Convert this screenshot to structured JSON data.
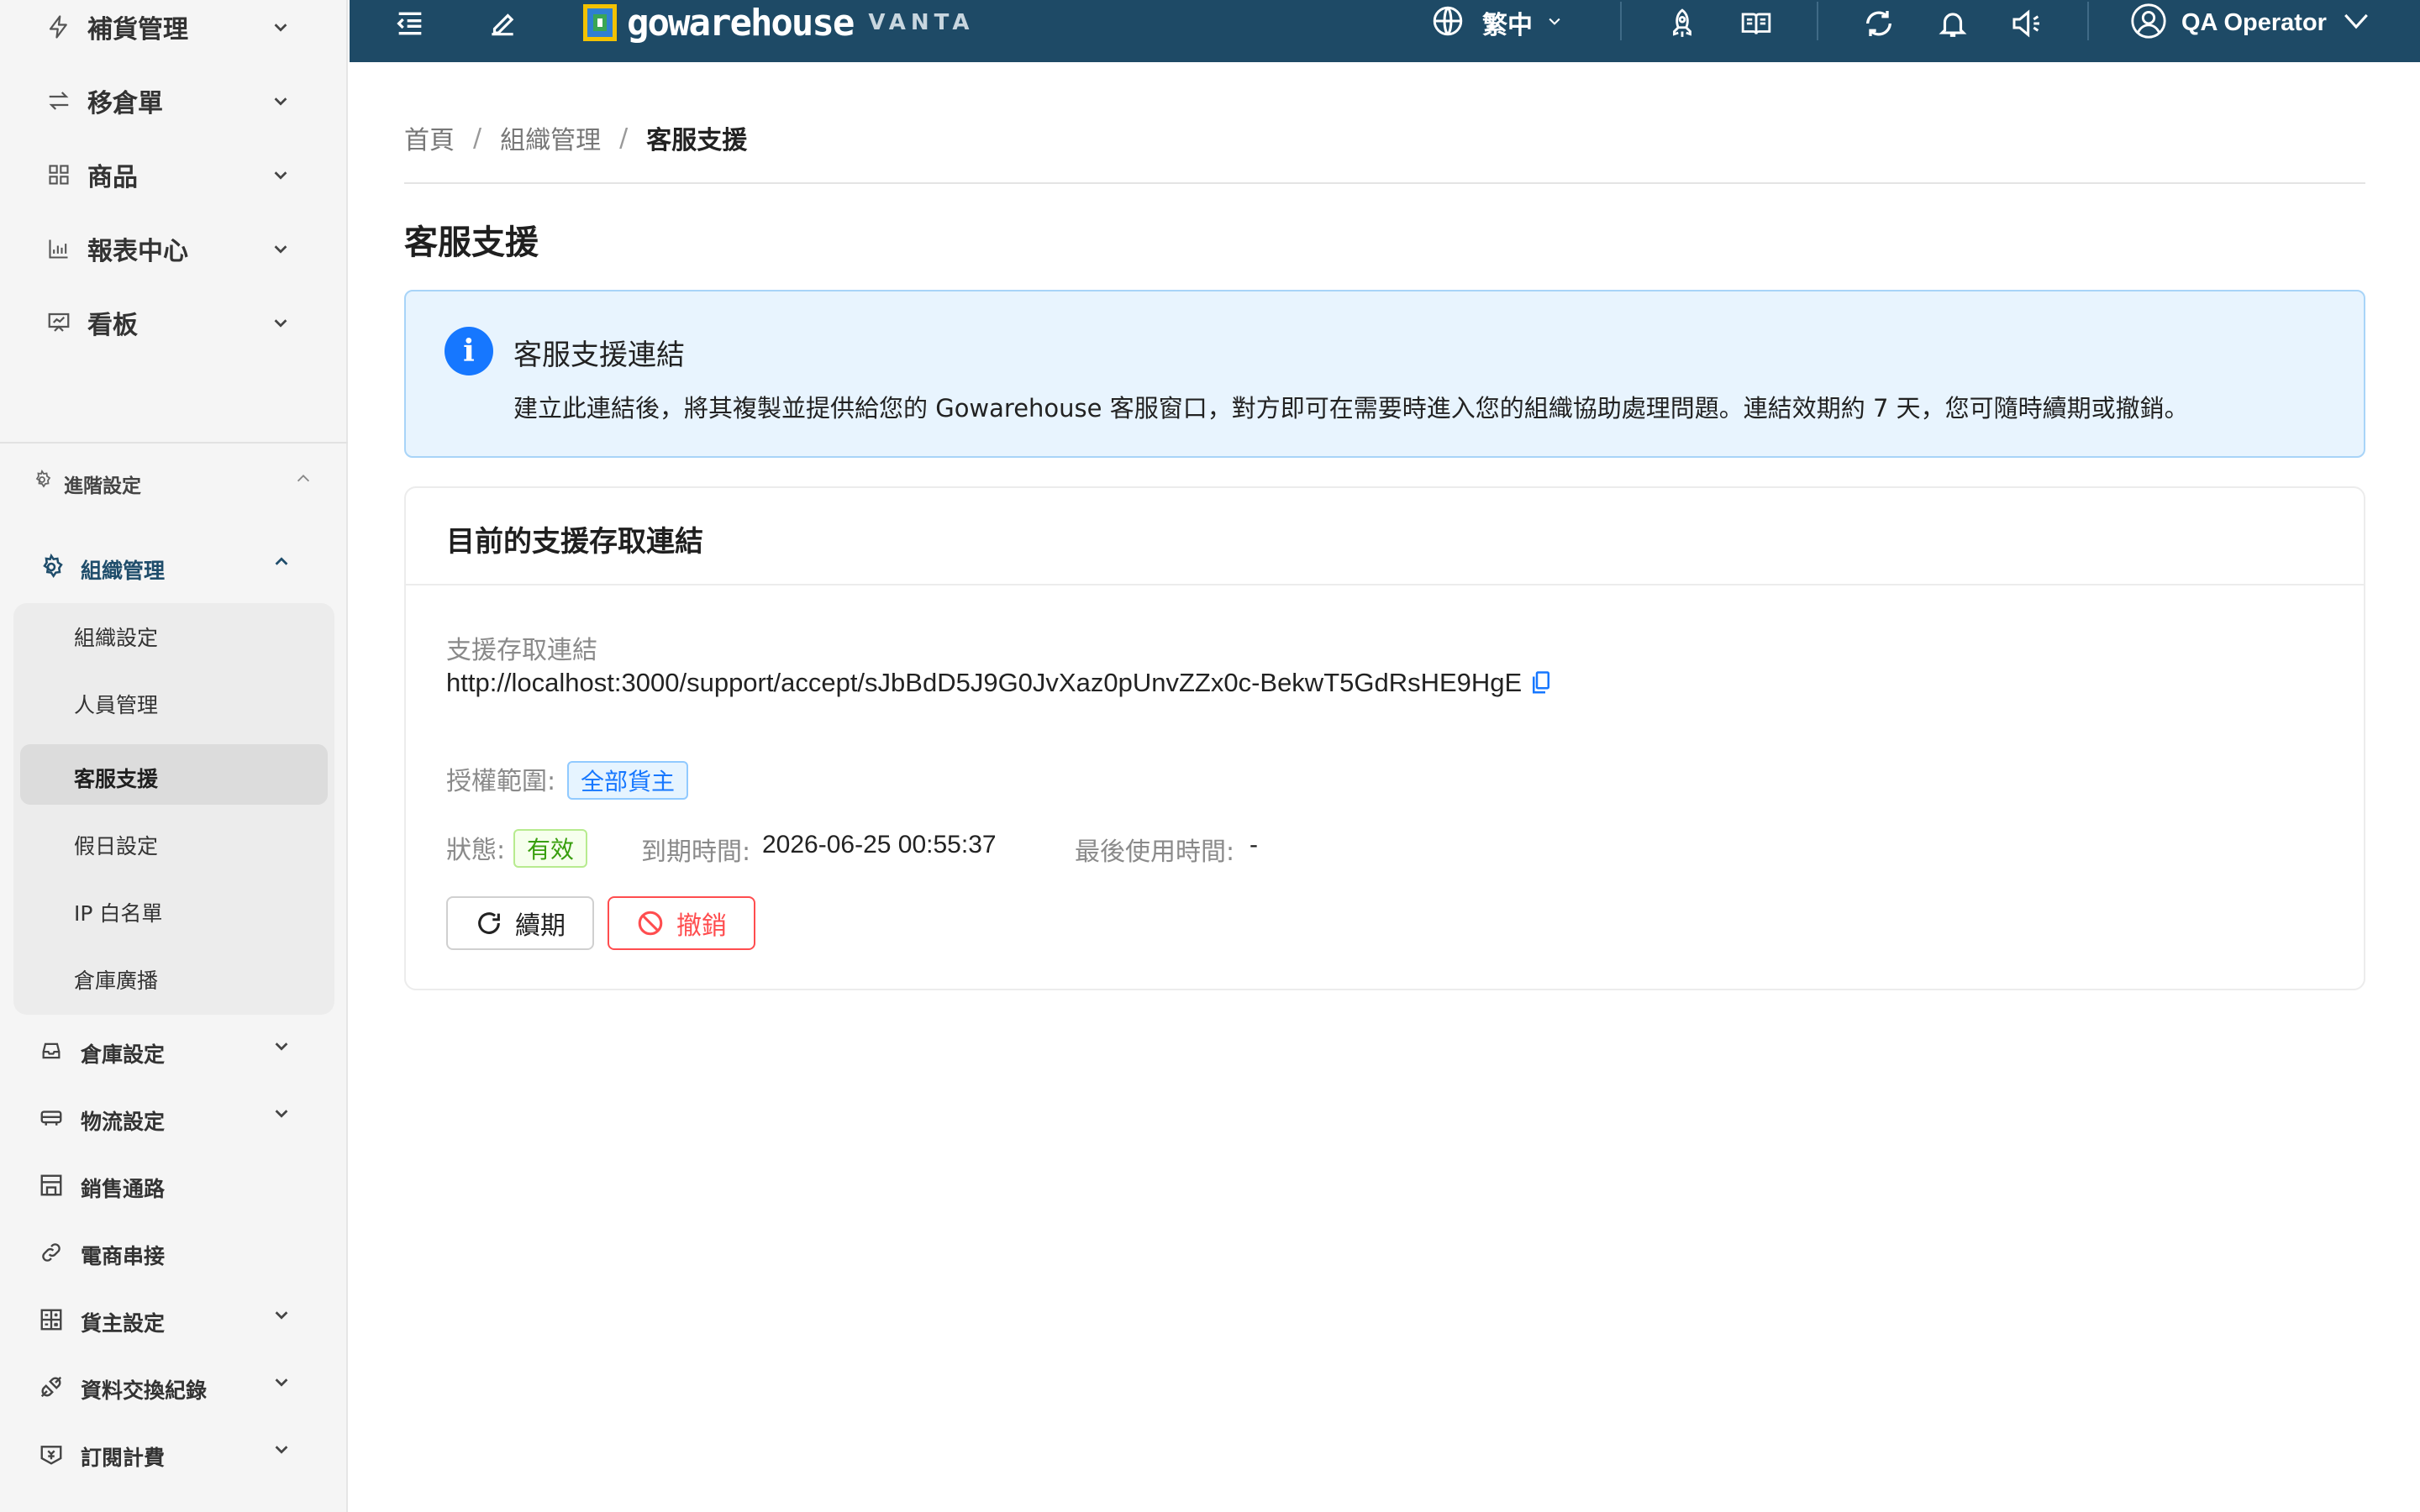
{
  "sidebar": {
    "top_items": [
      {
        "label": "補貨管理",
        "icon": "lightning-icon"
      },
      {
        "label": "移倉單",
        "icon": "transfer-icon"
      },
      {
        "label": "商品",
        "icon": "grid-icon"
      },
      {
        "label": "報表中心",
        "icon": "bar-chart-icon"
      },
      {
        "label": "看板",
        "icon": "presentation-icon"
      }
    ],
    "advanced_label": "進階設定",
    "org": {
      "label": "組織管理",
      "children": [
        "組織設定",
        "人員管理",
        "客服支援",
        "假日設定",
        "IP 白名單",
        "倉庫廣播"
      ],
      "active_index": 2
    },
    "bottom_items": [
      {
        "label": "倉庫設定",
        "icon": "inbox-icon",
        "has_children": true
      },
      {
        "label": "物流設定",
        "icon": "truck-icon",
        "has_children": true
      },
      {
        "label": "銷售通路",
        "icon": "shop-icon",
        "has_children": false
      },
      {
        "label": "電商串接",
        "icon": "link-icon",
        "has_children": false
      },
      {
        "label": "貨主設定",
        "icon": "calculator-icon",
        "has_children": true
      },
      {
        "label": "資料交換紀錄",
        "icon": "api-icon",
        "has_children": true
      },
      {
        "label": "訂閱計費",
        "icon": "money-collect-icon",
        "has_children": true
      }
    ]
  },
  "topbar": {
    "brand_name": "gowarehouse",
    "brand_sub": "VANTA",
    "language": "繁中",
    "user_name": "QA Operator"
  },
  "breadcrumb": {
    "home": "首頁",
    "org": "組織管理",
    "current": "客服支援",
    "separator": "/"
  },
  "page_title": "客服支援",
  "alert": {
    "title": "客服支援連結",
    "description": "建立此連結後，將其複製並提供給您的 Gowarehouse 客服窗口，對方即可在需要時進入您的組織協助處理問題。連結效期約 7 天，您可隨時續期或撤銷。"
  },
  "card": {
    "title": "目前的支援存取連結",
    "link_label": "支援存取連結",
    "link_url": "http://localhost:3000/support/accept/sJbBdD5J9G0JvXaz0pUnvZZx0c-BekwT5GdRsHE9HgE",
    "scope_label": "授權範圍:",
    "scope_value": "全部貨主",
    "status_label": "狀態:",
    "status_value": "有效",
    "expiry_label": "到期時間:",
    "expiry_value": "2026-06-25 00:55:37",
    "last_used_label": "最後使用時間:",
    "last_used_value": "-",
    "renew_label": "續期",
    "revoke_label": "撤銷"
  },
  "colors": {
    "topbar": "#1e4a66",
    "accent_blue": "#1677ff",
    "danger": "#ff4d4f",
    "success": "#389e0d"
  }
}
